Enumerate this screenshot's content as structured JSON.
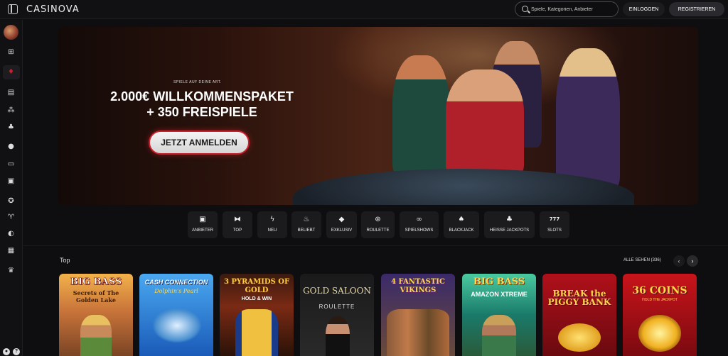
{
  "header": {
    "logo": "CASINOVA",
    "search_placeholder": "Spiele, Kategorien, Anbieter",
    "login_label": "EINLOGGEN",
    "register_label": "REGISTRIEREN"
  },
  "sidebar": {
    "icons": [
      "gift-icon",
      "casino-chip-icon",
      "slot-machine-icon",
      "dice-icon",
      "clover-icon",
      "football-icon",
      "live-icon",
      "tv-icon",
      "trophy-icon",
      "cup-icon",
      "pacman-icon",
      "store-icon",
      "crown-icon"
    ]
  },
  "hero": {
    "kicker": "SPIELE AUF DEINE ART.",
    "title_line1": "2.000€ WILLKOMMENSPAKET",
    "title_line2": "+ 350 FREISPIELE",
    "cta_label": "JETZT ANMELDEN"
  },
  "categories": [
    {
      "label": "ANBIETER",
      "icon": "provider-icon",
      "glyph": "▣"
    },
    {
      "label": "TOP",
      "icon": "crown-icon",
      "glyph": "⧓"
    },
    {
      "label": "NEU",
      "icon": "bolt-icon",
      "glyph": "ϟ"
    },
    {
      "label": "BELIEBT",
      "icon": "flame-icon",
      "glyph": "♨"
    },
    {
      "label": "EXKLUSIV",
      "icon": "diamond-icon",
      "glyph": "◆"
    },
    {
      "label": "ROULETTE",
      "icon": "roulette-icon",
      "glyph": "⊛"
    },
    {
      "label": "SPIELSHOWS",
      "icon": "mask-icon",
      "glyph": "∞"
    },
    {
      "label": "BLACKJACK",
      "icon": "cards-icon",
      "glyph": "♠"
    },
    {
      "label": "HEISSE JACKPOTS",
      "icon": "jackpot-icon",
      "glyph": "♣"
    },
    {
      "label": "SLOTS",
      "icon": "slots-icon",
      "glyph": "777"
    }
  ],
  "games_section": {
    "title": "Top",
    "see_all": "ALLE SEHEN (336)"
  },
  "games": [
    {
      "name": "BIG BASS",
      "subtitle": "Secrets of The Golden Lake"
    },
    {
      "name": "CASH CONNECTION",
      "subtitle": "Dolphin's Pearl"
    },
    {
      "name": "3 PYRAMIDS OF GOLD",
      "subtitle": "HOLD & WIN"
    },
    {
      "name": "GOLD SALOON",
      "subtitle": "ROULETTE"
    },
    {
      "name": "4 FANTASTIC VIKINGS",
      "subtitle": ""
    },
    {
      "name": "BIG BASS",
      "subtitle": "AMAZON XTREME"
    },
    {
      "name": "BREAK the PIGGY BANK",
      "subtitle": ""
    },
    {
      "name": "36 COINS",
      "subtitle": "HOLD THE JACKPOT"
    }
  ],
  "colors": {
    "background": "#0e0e10",
    "accent_red": "#c9202c",
    "surface": "#1b1b1e"
  }
}
